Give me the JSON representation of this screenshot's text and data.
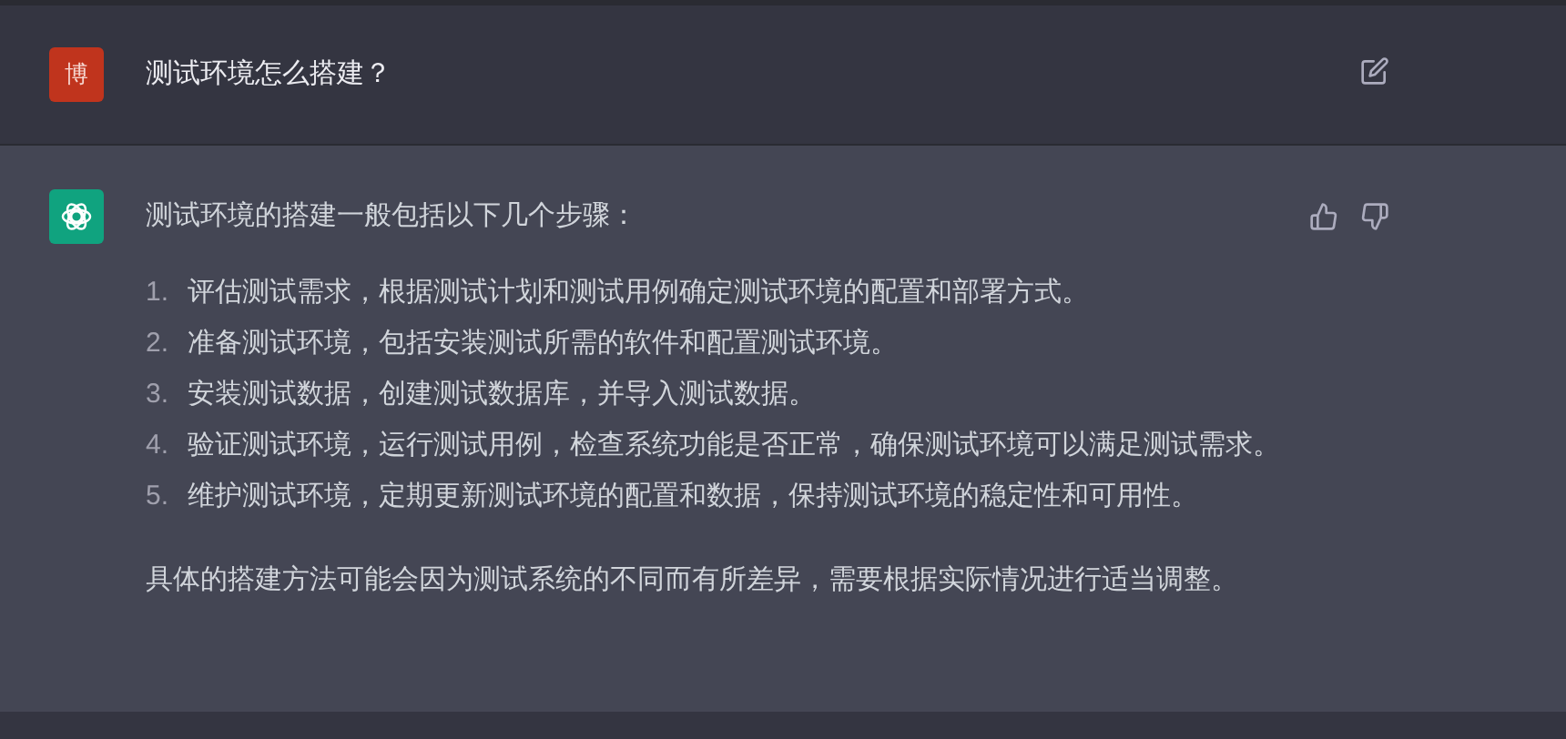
{
  "question": {
    "avatar": "博",
    "text": "测试环境怎么搭建？"
  },
  "answer": {
    "intro": "测试环境的搭建一般包括以下几个步骤：",
    "steps": [
      {
        "number": "1.",
        "text": "评估测试需求，根据测试计划和测试用例确定测试环境的配置和部署方式。"
      },
      {
        "number": "2.",
        "text": "准备测试环境，包括安装测试所需的软件和配置测试环境。"
      },
      {
        "number": "3.",
        "text": "安装测试数据，创建测试数据库，并导入测试数据。"
      },
      {
        "number": "4.",
        "text": "验证测试环境，运行测试用例，检查系统功能是否正常，确保测试环境可以满足测试需求。"
      },
      {
        "number": "5.",
        "text": "维护测试环境，定期更新测试环境的配置和数据，保持测试环境的稳定性和可用性。"
      }
    ],
    "conclusion": "具体的搭建方法可能会因为测试系统的不同而有所差异，需要根据实际情况进行适当调整。"
  }
}
